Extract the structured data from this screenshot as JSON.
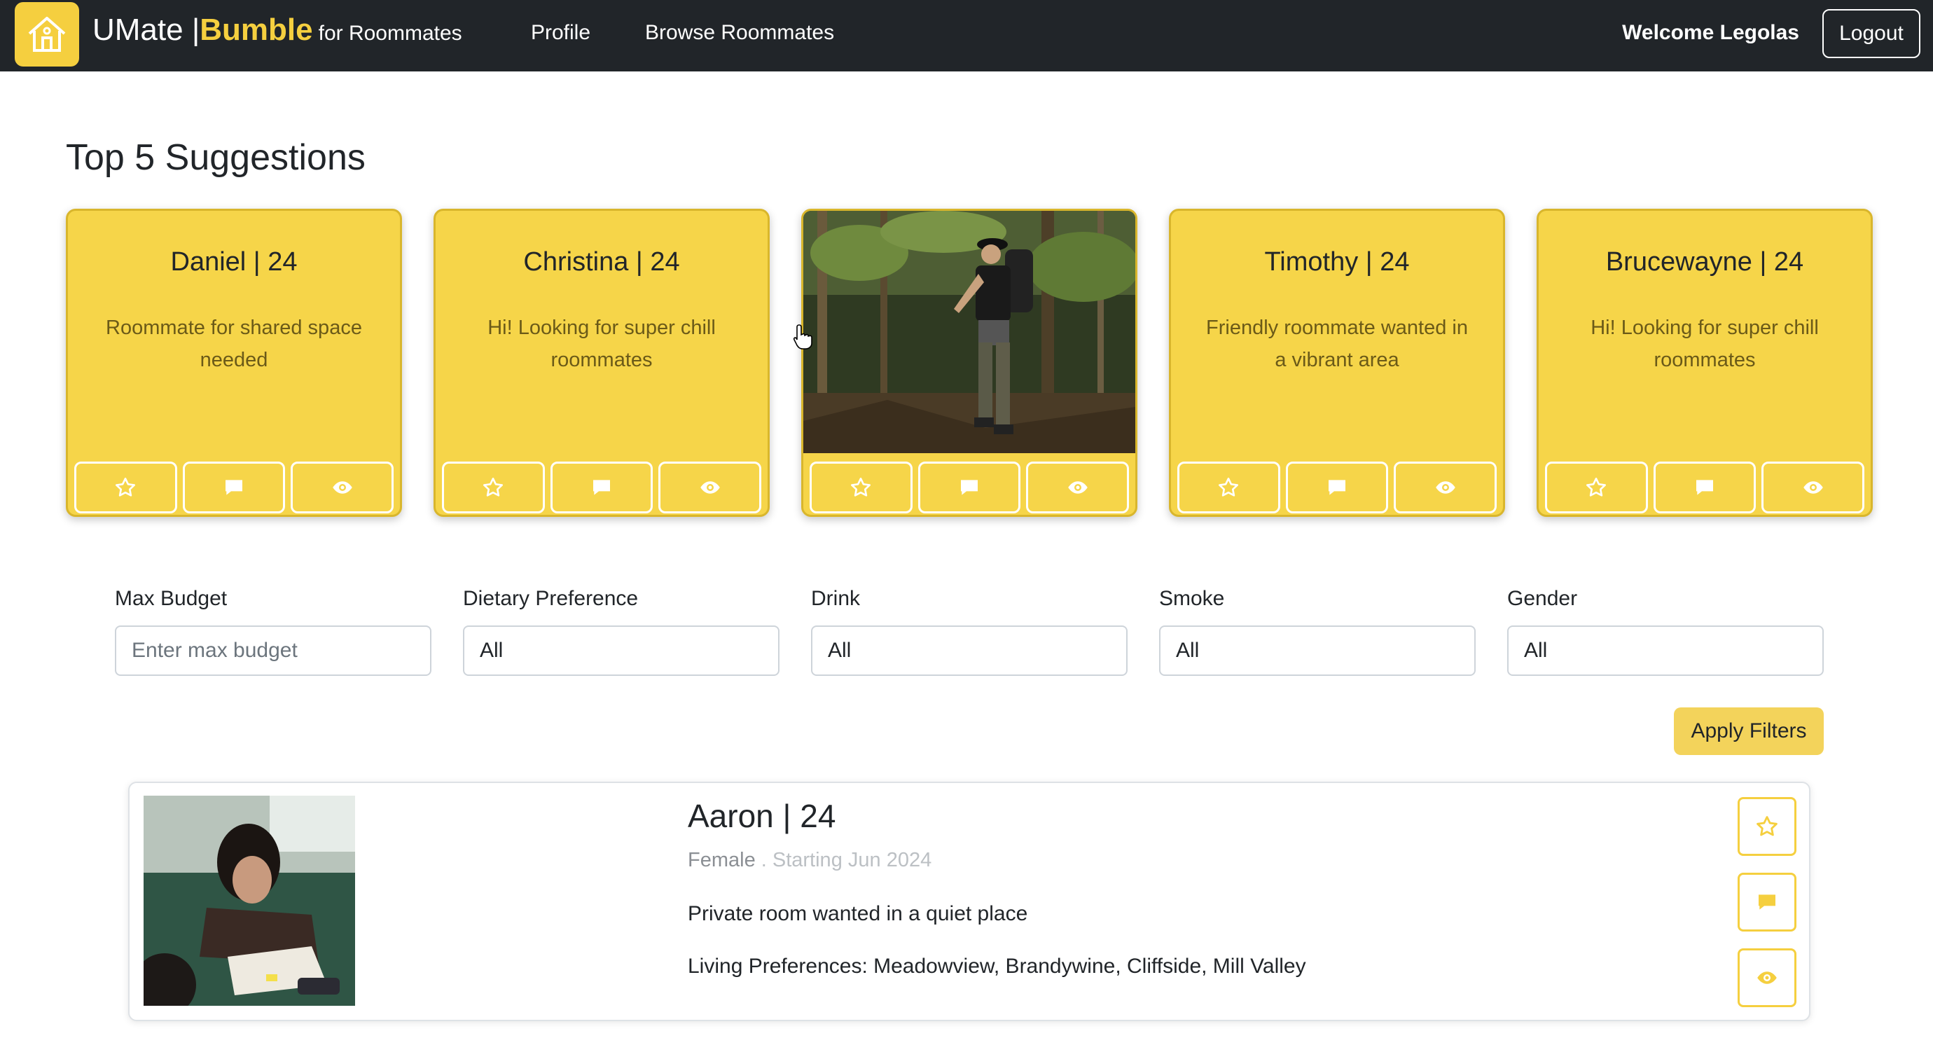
{
  "app": {
    "brand_main": "UMate | ",
    "brand_accent": "Bumble",
    "brand_suffix": "for Roommates",
    "accent_color": "#f5cf3f"
  },
  "nav": {
    "links": [
      "Profile",
      "Browse Roommates"
    ],
    "welcome": "Welcome Legolas",
    "logout": "Logout"
  },
  "suggestions": {
    "title": "Top 5 Suggestions",
    "cards": [
      {
        "name": "Daniel | 24",
        "bio": "Roommate for shared space needed"
      },
      {
        "name": "Christina | 24",
        "bio": "Hi! Looking for super chill roommates"
      },
      {
        "name": "",
        "bio": "",
        "image": "hiker-in-forest-photo"
      },
      {
        "name": "Timothy | 24",
        "bio": "Friendly roommate wanted in a vibrant area"
      },
      {
        "name": "Brucewayne | 24",
        "bio": "Hi! Looking for super chill roommates"
      }
    ],
    "action_icons": [
      "star-icon",
      "chat-icon",
      "eye-icon"
    ]
  },
  "filters": {
    "max_budget": {
      "label": "Max Budget",
      "placeholder": "Enter max budget"
    },
    "dietary": {
      "label": "Dietary Preference",
      "value": "All"
    },
    "drink": {
      "label": "Drink",
      "value": "All"
    },
    "smoke": {
      "label": "Smoke",
      "value": "All"
    },
    "gender": {
      "label": "Gender",
      "value": "All"
    },
    "apply": "Apply Filters"
  },
  "result": {
    "name": "Aaron | 24",
    "gender": "Female",
    "start": " . Starting Jun 2024",
    "bio": "Private room wanted in a quiet place",
    "preferences": "Living Preferences: Meadowview, Brandywine, Cliffside, Mill Valley"
  }
}
